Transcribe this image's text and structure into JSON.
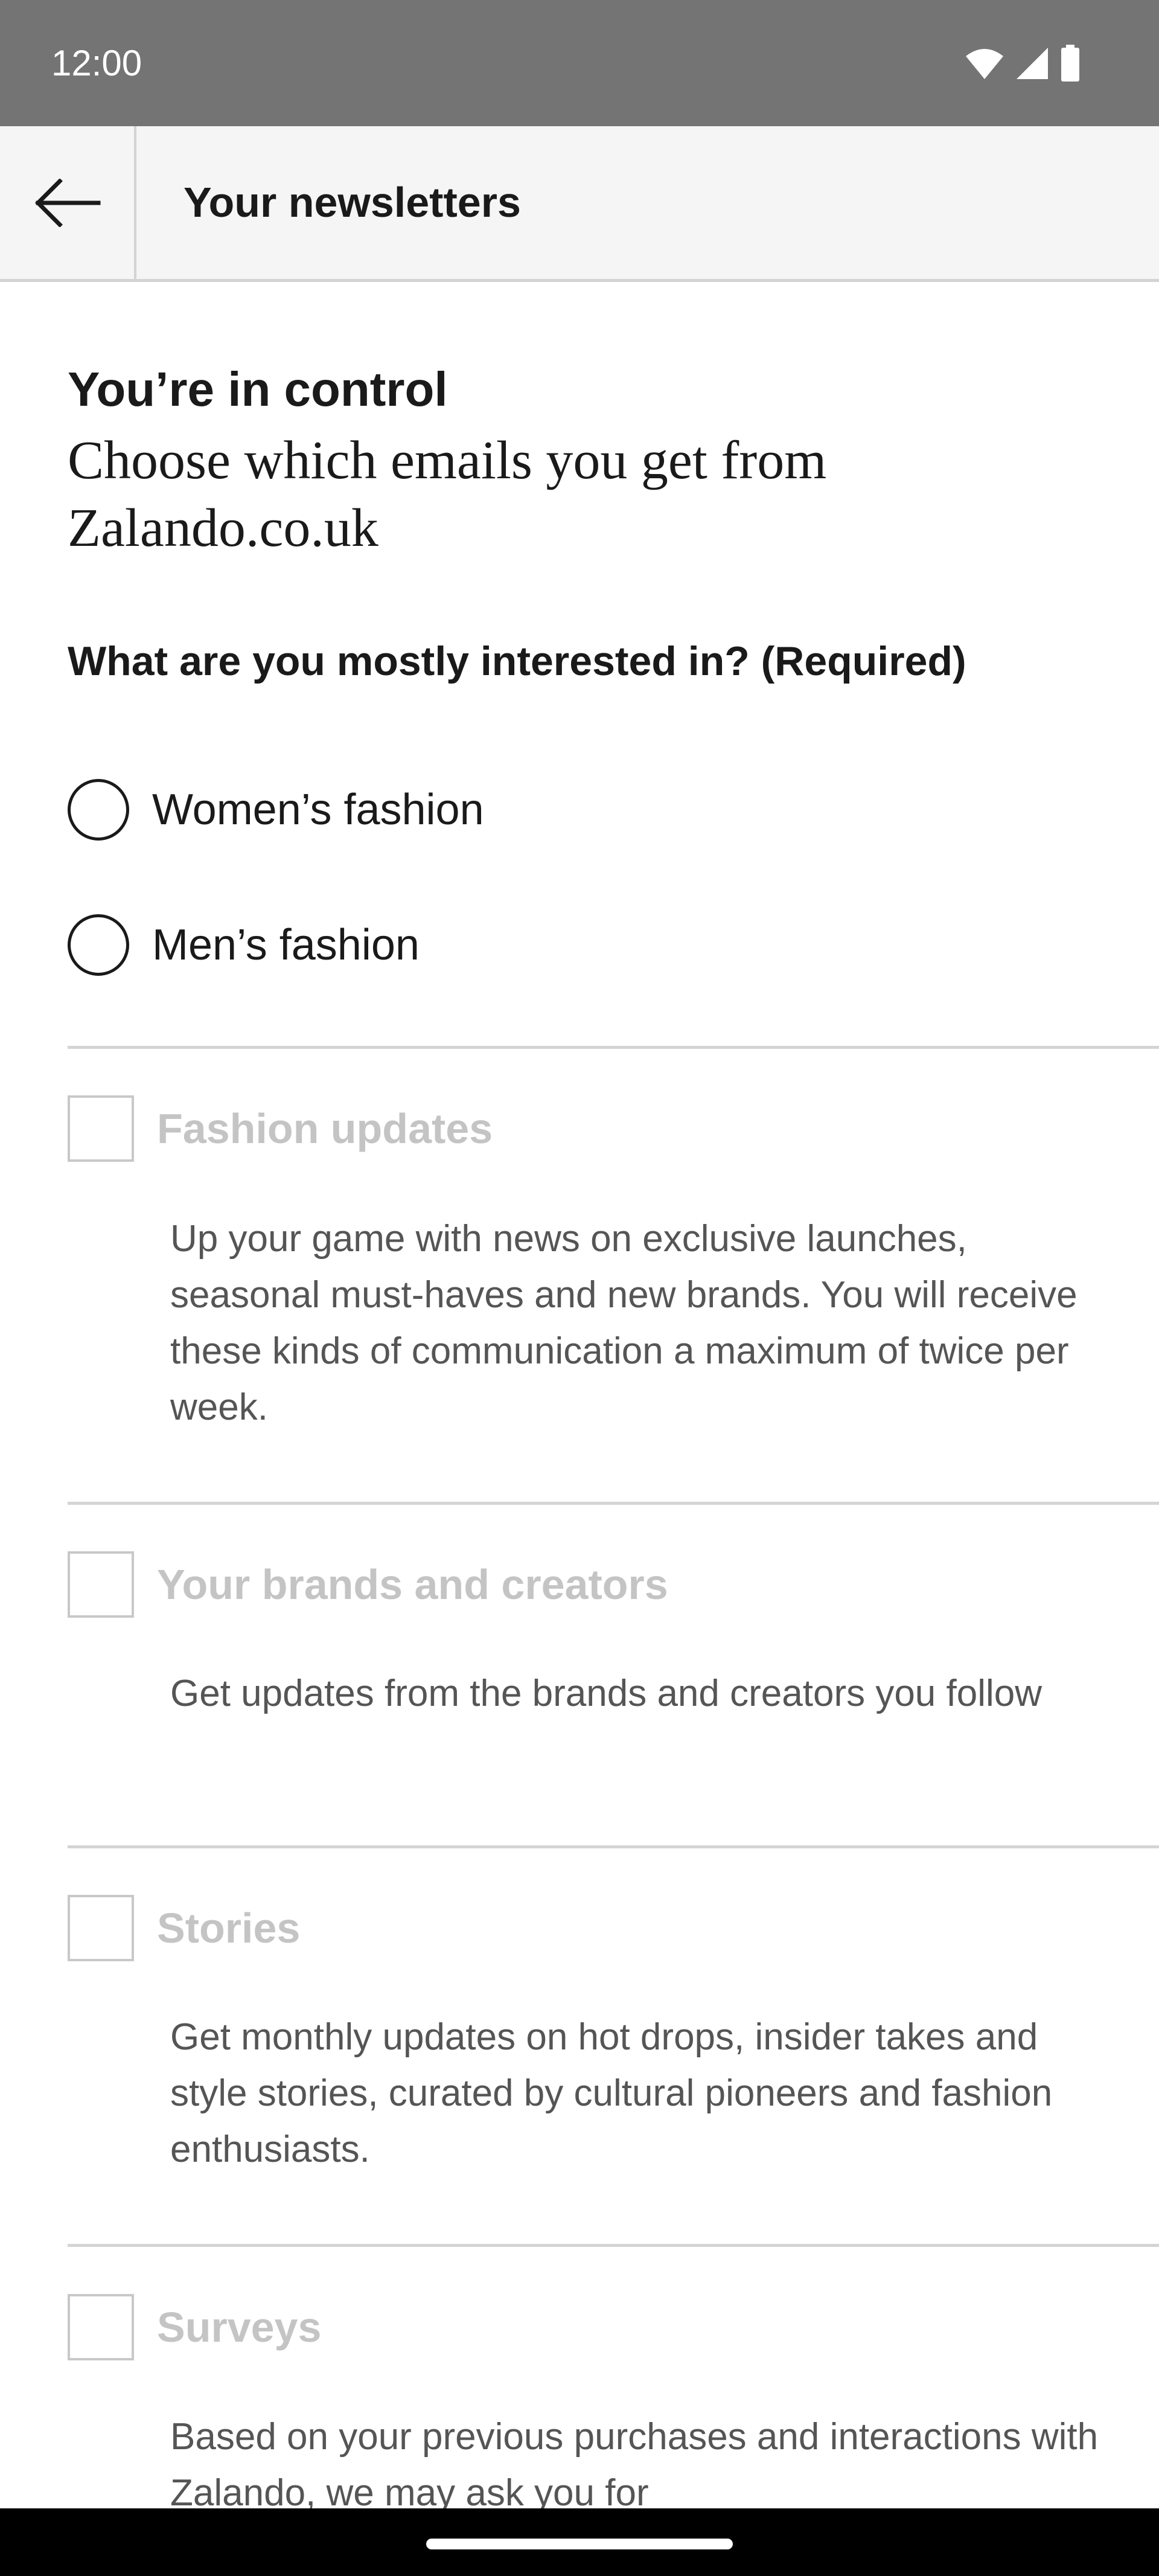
{
  "status_bar": {
    "time": "12:00",
    "icons": [
      "wifi-icon",
      "signal-icon",
      "battery-icon"
    ]
  },
  "app_bar": {
    "back_icon": "arrow-left-icon",
    "title": "Your newsletters"
  },
  "main": {
    "headline": "You’re in control",
    "subheadline": "Choose which emails you get from Zalando.co.uk",
    "question": "What are you mostly interested in? (Required)",
    "interests": [
      {
        "label": "Women’s fashion",
        "selected": false
      },
      {
        "label": "Men’s fashion",
        "selected": false
      }
    ],
    "newsletters": [
      {
        "title": "Fashion updates",
        "checked": false,
        "description": "Up your game with news on exclusive launches, seasonal must-haves and new brands. You will receive these kinds of communication a maximum of twice per week."
      },
      {
        "title": "Your brands and creators",
        "checked": false,
        "description": "Get updates from the brands and creators you follow"
      },
      {
        "title": "Stories",
        "checked": false,
        "description": "Get monthly updates on hot drops, insider takes and style stories, curated by cultural pioneers and fashion enthusiasts."
      },
      {
        "title": "Surveys",
        "checked": false,
        "description": "Based on your previous purchases and interactions with Zalando, we may ask you for"
      }
    ]
  },
  "colors": {
    "status_bar": "#747474",
    "app_bar": "#f5f5f5",
    "divider": "#d4d4d4",
    "disabled_text": "#c4c4c4",
    "body_text": "#555555",
    "nav_bar": "#000000"
  }
}
